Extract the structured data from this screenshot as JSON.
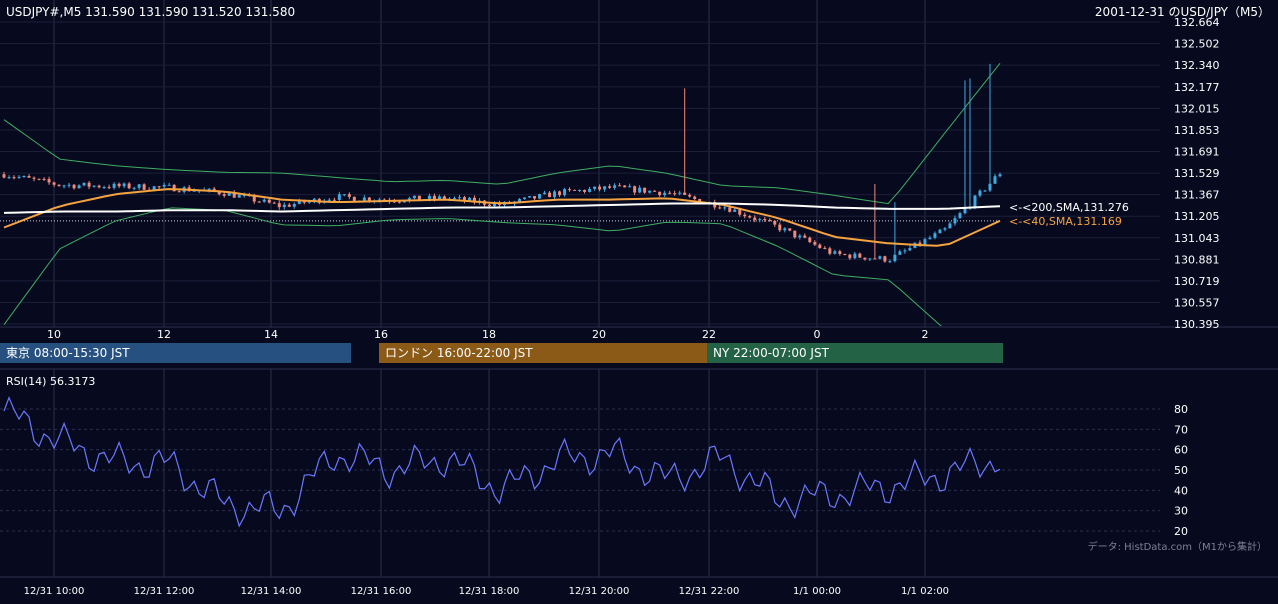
{
  "header": {
    "symbol_info": "USDJPY#,M5 131.590 131.590 131.520 131.580",
    "title": "2001-12-31 のUSD/JPY（M5）"
  },
  "main_chart": {
    "y_ticks": [
      "132.664",
      "132.502",
      "132.340",
      "132.177",
      "132.015",
      "131.853",
      "131.691",
      "131.529",
      "131.367",
      "131.205",
      "131.043",
      "130.881",
      "130.719",
      "130.557",
      "130.395"
    ],
    "x_ticks": [
      "10",
      "12",
      "14",
      "16",
      "18",
      "20",
      "22",
      "0",
      "2"
    ],
    "sma200_label": "<-<200,SMA,131.276",
    "sma40_label": "<-<40,SMA,131.169"
  },
  "sessions": [
    {
      "label": "東京 08:00-15:30 JST",
      "color": "#26507f"
    },
    {
      "label": "ロンドン 16:00-22:00 JST",
      "color": "#8a5a16"
    },
    {
      "label": "NY 22:00-07:00 JST",
      "color": "#236244"
    }
  ],
  "rsi_panel": {
    "label": "RSI(14) 56.3173",
    "y_ticks": [
      "80",
      "70",
      "60",
      "50",
      "40",
      "30",
      "20"
    ],
    "credit": "データ: HistData.com（M1から集計）"
  },
  "bottom_axis": {
    "ticks": [
      "12/31 10:00",
      "12/31 12:00",
      "12/31 14:00",
      "12/31 16:00",
      "12/31 18:00",
      "12/31 20:00",
      "12/31 22:00",
      "1/1 00:00",
      "1/1 02:00"
    ]
  },
  "colors": {
    "background": "#070a1f",
    "up_candle": "#3fa9e0",
    "down_candle": "#f08a7a",
    "sma200": "#ffffff",
    "sma40": "#f5a340",
    "bollinger": "#3fae62",
    "rsi": "#6a78ff"
  },
  "chart_data": [
    {
      "type": "line",
      "name": "USDJPY M5",
      "x": [
        "12/31 09:00",
        "12/31 10:00",
        "12/31 11:00",
        "12/31 12:00",
        "12/31 13:00",
        "12/31 14:00",
        "12/31 15:00",
        "12/31 16:00",
        "12/31 17:00",
        "12/31 18:00",
        "12/31 19:00",
        "12/31 20:00",
        "12/31 21:00",
        "12/31 22:00",
        "12/31 23:00",
        "1/1 00:00",
        "1/1 01:00",
        "1/1 02:00",
        "1/1 03:00"
      ],
      "series": [
        {
          "name": "Close",
          "values": [
            131.52,
            131.44,
            131.43,
            131.42,
            131.38,
            131.28,
            131.35,
            131.33,
            131.34,
            131.29,
            131.38,
            131.42,
            131.38,
            131.28,
            131.12,
            130.92,
            130.88,
            131.1,
            131.53
          ]
        },
        {
          "name": "SMA 40",
          "values": [
            131.12,
            131.28,
            131.37,
            131.41,
            131.39,
            131.33,
            131.31,
            131.32,
            131.33,
            131.3,
            131.33,
            131.33,
            131.34,
            131.29,
            131.19,
            131.05,
            131.0,
            130.98,
            131.17
          ]
        },
        {
          "name": "SMA 200",
          "values": [
            131.23,
            131.24,
            131.24,
            131.25,
            131.25,
            131.24,
            131.25,
            131.26,
            131.27,
            131.27,
            131.28,
            131.29,
            131.3,
            131.3,
            131.29,
            131.27,
            131.26,
            131.26,
            131.28
          ]
        }
      ],
      "ylim": [
        130.395,
        132.664
      ],
      "y_ticks": [
        132.664,
        132.502,
        132.34,
        132.177,
        132.015,
        131.853,
        131.691,
        131.529,
        131.367,
        131.205,
        131.043,
        130.881,
        130.719,
        130.557,
        130.395
      ],
      "grid": true
    },
    {
      "type": "line",
      "name": "RSI(14)",
      "x": [
        "12/31 09:00",
        "12/31 10:00",
        "12/31 11:00",
        "12/31 12:00",
        "12/31 13:00",
        "12/31 14:00",
        "12/31 15:00",
        "12/31 16:00",
        "12/31 17:00",
        "12/31 18:00",
        "12/31 19:00",
        "12/31 20:00",
        "12/31 21:00",
        "12/31 22:00",
        "12/31 23:00",
        "1/1 00:00",
        "1/1 01:00",
        "1/1 02:00",
        "1/1 03:00"
      ],
      "series": [
        {
          "name": "RSI(14)",
          "values": [
            79,
            64,
            54,
            53,
            33,
            30,
            58,
            50,
            56,
            40,
            55,
            58,
            45,
            56,
            35,
            38,
            42,
            48,
            56
          ]
        }
      ],
      "ylim": [
        20,
        85
      ],
      "y_ticks": [
        80,
        70,
        60,
        50,
        40,
        30,
        20
      ],
      "grid": true
    }
  ]
}
